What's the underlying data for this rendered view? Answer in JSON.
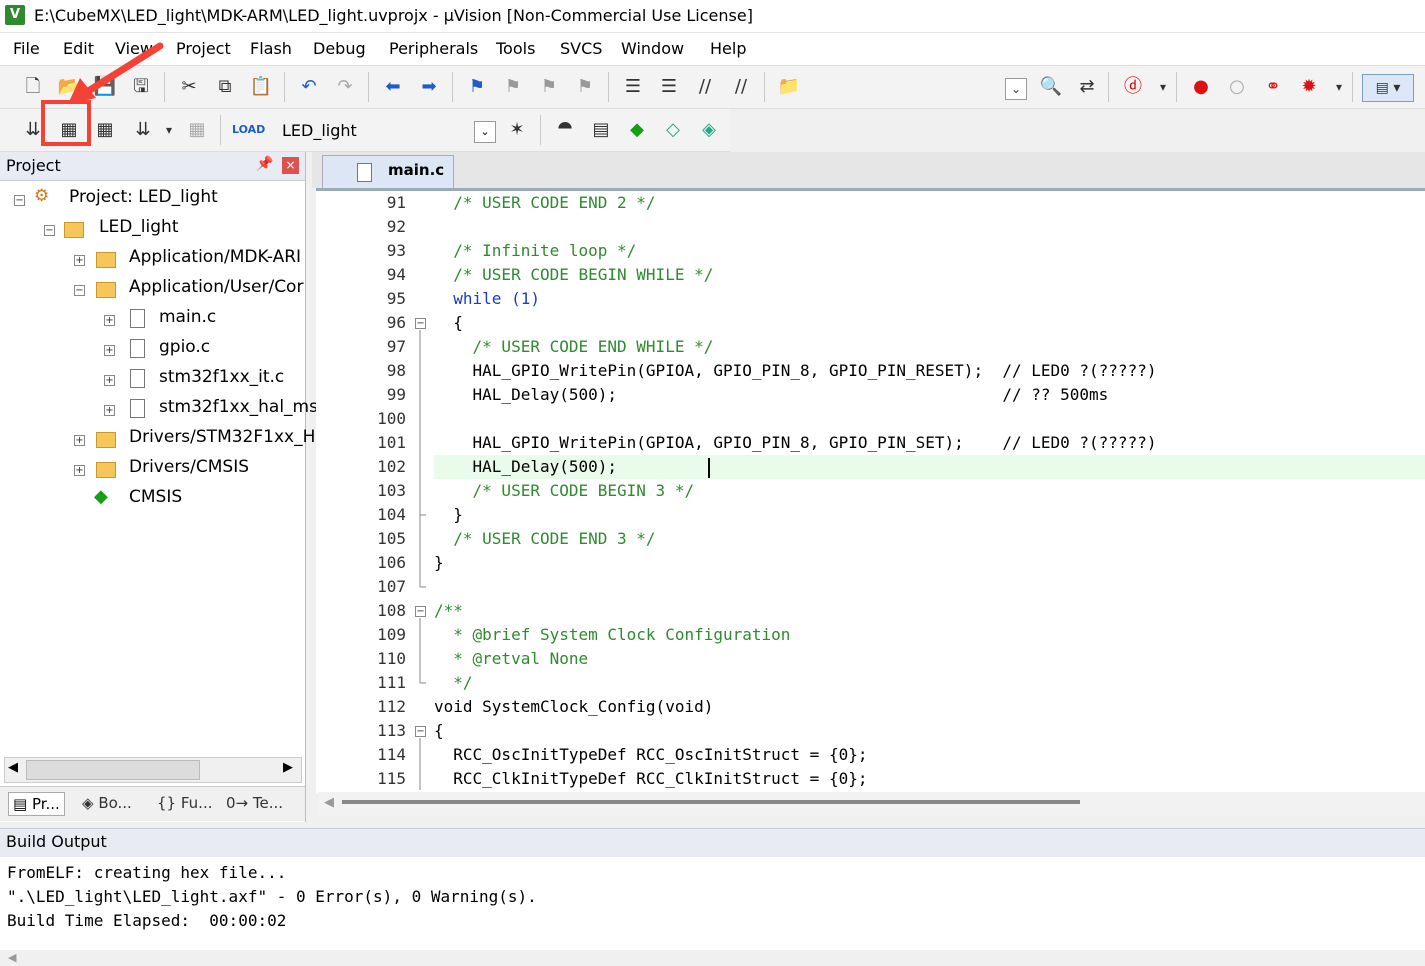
{
  "window": {
    "title": "E:\\CubeMX\\LED_light\\MDK-ARM\\LED_light.uvprojx - µVision  [Non-Commercial Use License]"
  },
  "menu": [
    "File",
    "Edit",
    "View",
    "Project",
    "Flash",
    "Debug",
    "Peripherals",
    "Tools",
    "SVCS",
    "Window",
    "Help"
  ],
  "toolbar": {
    "target": "LED_light"
  },
  "project": {
    "title": "Project",
    "tree": [
      {
        "label": "Project: LED_light"
      },
      {
        "label": "LED_light"
      },
      {
        "label": "Application/MDK-ARI"
      },
      {
        "label": "Application/User/Cor"
      },
      {
        "label": "main.c"
      },
      {
        "label": "gpio.c"
      },
      {
        "label": "stm32f1xx_it.c"
      },
      {
        "label": "stm32f1xx_hal_ms"
      },
      {
        "label": "Drivers/STM32F1xx_H."
      },
      {
        "label": "Drivers/CMSIS"
      },
      {
        "label": "CMSIS"
      }
    ],
    "tabs": [
      "Pr...",
      "Bo...",
      "Fu...",
      "Te..."
    ]
  },
  "editor": {
    "tab": "main.c",
    "line_numbers": [
      "91",
      "92",
      "93",
      "94",
      "95",
      "96",
      "97",
      "98",
      "99",
      "100",
      "101",
      "102",
      "103",
      "104",
      "105",
      "106",
      "107",
      "108",
      "109",
      "110",
      "111",
      "112",
      "113",
      "114",
      "115"
    ],
    "lines": [
      "  /* USER CODE END 2 */",
      "",
      "  /* Infinite loop */",
      "  /* USER CODE BEGIN WHILE */",
      "  while (1)",
      "  {",
      "    /* USER CODE END WHILE */",
      "    HAL_GPIO_WritePin(GPIOA, GPIO_PIN_8, GPIO_PIN_RESET);  // LED0 ?(?????)",
      "    HAL_Delay(500);                                        // ?? 500ms",
      "",
      "    HAL_GPIO_WritePin(GPIOA, GPIO_PIN_8, GPIO_PIN_SET);    // LED0 ?(?????)",
      "    HAL_Delay(500);",
      "    /* USER CODE BEGIN 3 */",
      "  }",
      "  /* USER CODE END 3 */",
      "}",
      "",
      "/**",
      "  * @brief System Clock Configuration",
      "  * @retval None",
      "  */",
      "void SystemClock_Config(void)",
      "{",
      "  RCC_OscInitTypeDef RCC_OscInitStruct = {0};",
      "  RCC_ClkInitTypeDef RCC_ClkInitStruct = {0};"
    ]
  },
  "build": {
    "title": "Build Output",
    "lines": [
      "FromELF: creating hex file...",
      "\".\\LED_light\\LED_light.axf\" - 0 Error(s), 0 Warning(s).",
      "Build Time Elapsed:  00:00:02"
    ]
  }
}
